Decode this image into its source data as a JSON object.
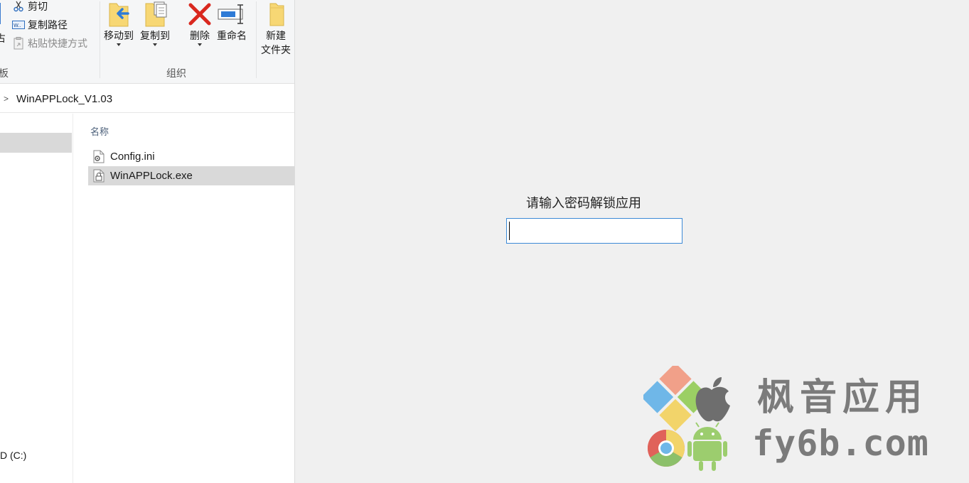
{
  "ribbon": {
    "clipboard": {
      "cut_label": "剪切",
      "copy_path_label": "复制路径",
      "paste_shortcut_label": "粘贴快捷方式",
      "group_label_partial": "板",
      "left_partial_label": "占"
    },
    "organize": {
      "move_to_label": "移动到",
      "copy_to_label": "复制到",
      "delete_label": "删除",
      "rename_label": "重命名",
      "group_label": "组织"
    },
    "new": {
      "new_folder_line1": "新建",
      "new_folder_line2": "文件夹"
    }
  },
  "address_bar": {
    "chevron": ">",
    "path": "WinAPPLock_V1.03"
  },
  "nav_pane": {
    "drive_label": "D (C:)"
  },
  "file_list": {
    "column_name": "名称",
    "files": [
      {
        "name": "Config.ini",
        "icon": "settings-file-icon",
        "selected": false
      },
      {
        "name": "WinAPPLock.exe",
        "icon": "lock-app-icon",
        "selected": true
      }
    ]
  },
  "lock_dialog": {
    "prompt": "请输入密码解锁应用",
    "password_value": "",
    "accent": "#3c8ad6"
  },
  "watermark": {
    "cn_text": "枫音应用",
    "domain_text": "fy6b.com",
    "logos": [
      "windows-logo-icon",
      "apple-logo-icon",
      "chrome-logo-icon",
      "android-logo-icon"
    ]
  }
}
